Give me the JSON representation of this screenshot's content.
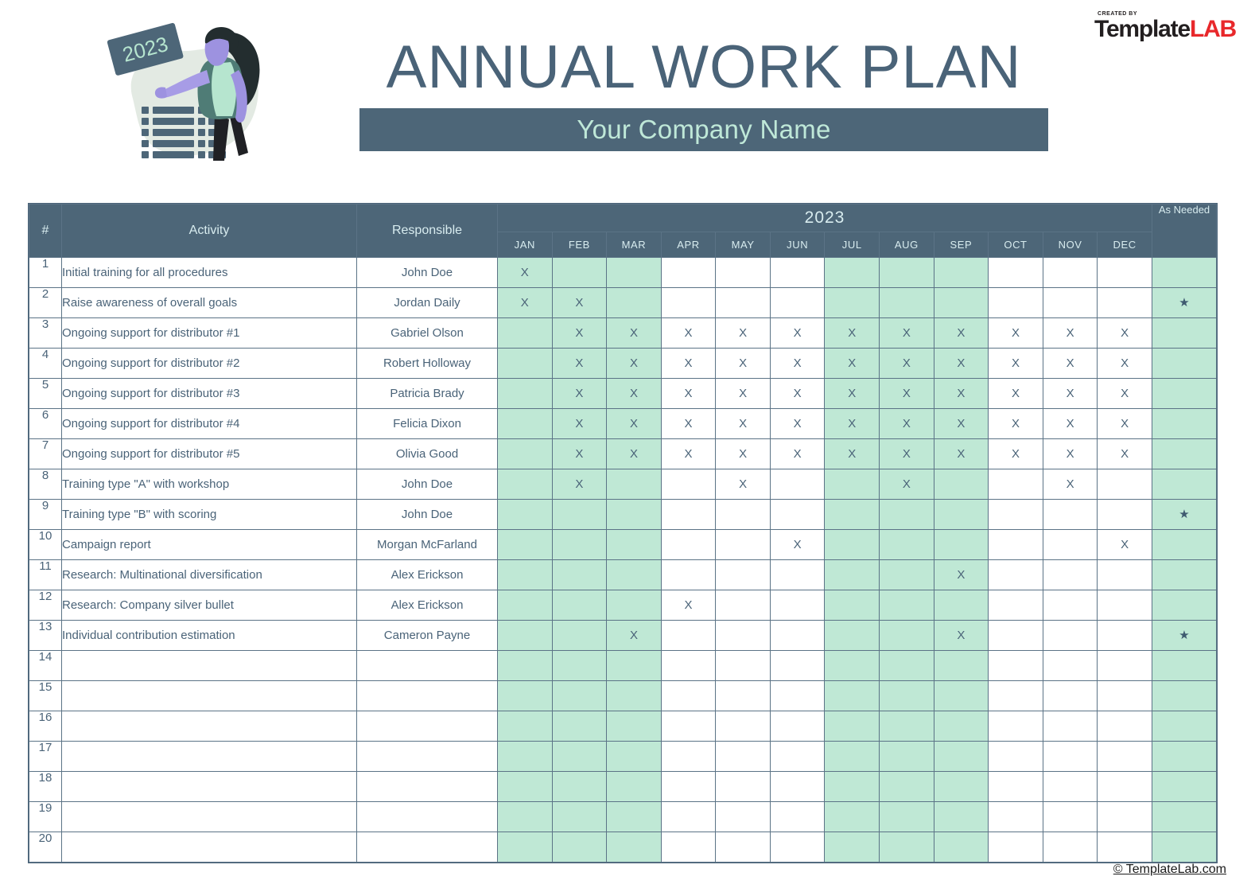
{
  "brand": {
    "created_by": "CREATED BY",
    "name_dark": "Template",
    "name_red": "LAB"
  },
  "header": {
    "title": "ANNUAL WORK PLAN",
    "company_name": "Your Company Name",
    "illustration_year": "2023",
    "illustration_name": "planner-woman-illustration"
  },
  "table": {
    "columns": {
      "number": "#",
      "activity": "Activity",
      "responsible": "Responsible",
      "year": "2023",
      "as_needed": "As Needed"
    },
    "months": [
      "JAN",
      "FEB",
      "MAR",
      "APR",
      "MAY",
      "JUN",
      "JUL",
      "AUG",
      "SEP",
      "OCT",
      "NOV",
      "DEC"
    ],
    "mark": "X",
    "star": "★",
    "shaded_month_indexes": [
      0,
      1,
      2,
      6,
      7,
      8
    ],
    "rows": [
      {
        "num": "1",
        "activity": "Initial training for all procedures",
        "responsible": "John Doe",
        "months": [
          "X",
          "",
          "",
          "",
          "",
          "",
          "",
          "",
          "",
          "",
          "",
          ""
        ],
        "as_needed": ""
      },
      {
        "num": "2",
        "activity": "Raise awareness of overall goals",
        "responsible": "Jordan Daily",
        "months": [
          "X",
          "X",
          "",
          "",
          "",
          "",
          "",
          "",
          "",
          "",
          "",
          ""
        ],
        "as_needed": "★"
      },
      {
        "num": "3",
        "activity": "Ongoing support for distributor #1",
        "responsible": "Gabriel Olson",
        "months": [
          "",
          "X",
          "X",
          "X",
          "X",
          "X",
          "X",
          "X",
          "X",
          "X",
          "X",
          "X"
        ],
        "as_needed": ""
      },
      {
        "num": "4",
        "activity": "Ongoing support for distributor #2",
        "responsible": "Robert Holloway",
        "months": [
          "",
          "X",
          "X",
          "X",
          "X",
          "X",
          "X",
          "X",
          "X",
          "X",
          "X",
          "X"
        ],
        "as_needed": ""
      },
      {
        "num": "5",
        "activity": "Ongoing support for distributor #3",
        "responsible": "Patricia Brady",
        "months": [
          "",
          "X",
          "X",
          "X",
          "X",
          "X",
          "X",
          "X",
          "X",
          "X",
          "X",
          "X"
        ],
        "as_needed": ""
      },
      {
        "num": "6",
        "activity": "Ongoing support for distributor #4",
        "responsible": "Felicia Dixon",
        "months": [
          "",
          "X",
          "X",
          "X",
          "X",
          "X",
          "X",
          "X",
          "X",
          "X",
          "X",
          "X"
        ],
        "as_needed": ""
      },
      {
        "num": "7",
        "activity": "Ongoing support for distributor #5",
        "responsible": "Olivia Good",
        "months": [
          "",
          "X",
          "X",
          "X",
          "X",
          "X",
          "X",
          "X",
          "X",
          "X",
          "X",
          "X"
        ],
        "as_needed": ""
      },
      {
        "num": "8",
        "activity": "Training type \"A\" with workshop",
        "responsible": "John Doe",
        "months": [
          "",
          "X",
          "",
          "",
          "X",
          "",
          "",
          "X",
          "",
          "",
          "X",
          ""
        ],
        "as_needed": ""
      },
      {
        "num": "9",
        "activity": "Training type \"B\" with scoring",
        "responsible": "John Doe",
        "months": [
          "",
          "",
          "",
          "",
          "",
          "",
          "",
          "",
          "",
          "",
          "",
          ""
        ],
        "as_needed": "★"
      },
      {
        "num": "10",
        "activity": "Campaign report",
        "responsible": "Morgan McFarland",
        "months": [
          "",
          "",
          "",
          "",
          "",
          "X",
          "",
          "",
          "",
          "",
          "",
          "X"
        ],
        "as_needed": ""
      },
      {
        "num": "11",
        "activity": "Research: Multinational diversification",
        "responsible": "Alex Erickson",
        "months": [
          "",
          "",
          "",
          "",
          "",
          "",
          "",
          "",
          "X",
          "",
          "",
          ""
        ],
        "as_needed": ""
      },
      {
        "num": "12",
        "activity": "Research: Company silver bullet",
        "responsible": "Alex Erickson",
        "months": [
          "",
          "",
          "",
          "X",
          "",
          "",
          "",
          "",
          "",
          "",
          "",
          ""
        ],
        "as_needed": ""
      },
      {
        "num": "13",
        "activity": "Individual contribution estimation",
        "responsible": "Cameron Payne",
        "months": [
          "",
          "",
          "X",
          "",
          "",
          "",
          "",
          "",
          "X",
          "",
          "",
          ""
        ],
        "as_needed": "★"
      },
      {
        "num": "14",
        "activity": "",
        "responsible": "",
        "months": [
          "",
          "",
          "",
          "",
          "",
          "",
          "",
          "",
          "",
          "",
          "",
          ""
        ],
        "as_needed": ""
      },
      {
        "num": "15",
        "activity": "",
        "responsible": "",
        "months": [
          "",
          "",
          "",
          "",
          "",
          "",
          "",
          "",
          "",
          "",
          "",
          ""
        ],
        "as_needed": ""
      },
      {
        "num": "16",
        "activity": "",
        "responsible": "",
        "months": [
          "",
          "",
          "",
          "",
          "",
          "",
          "",
          "",
          "",
          "",
          "",
          ""
        ],
        "as_needed": ""
      },
      {
        "num": "17",
        "activity": "",
        "responsible": "",
        "months": [
          "",
          "",
          "",
          "",
          "",
          "",
          "",
          "",
          "",
          "",
          "",
          ""
        ],
        "as_needed": ""
      },
      {
        "num": "18",
        "activity": "",
        "responsible": "",
        "months": [
          "",
          "",
          "",
          "",
          "",
          "",
          "",
          "",
          "",
          "",
          "",
          ""
        ],
        "as_needed": ""
      },
      {
        "num": "19",
        "activity": "",
        "responsible": "",
        "months": [
          "",
          "",
          "",
          "",
          "",
          "",
          "",
          "",
          "",
          "",
          "",
          ""
        ],
        "as_needed": ""
      },
      {
        "num": "20",
        "activity": "",
        "responsible": "",
        "months": [
          "",
          "",
          "",
          "",
          "",
          "",
          "",
          "",
          "",
          "",
          "",
          ""
        ],
        "as_needed": ""
      }
    ]
  },
  "footer": {
    "copyright": "© TemplateLab.com"
  },
  "colors": {
    "header_slate": "#4D6678",
    "title_slate": "#4A6378",
    "mint": "#BFE8D5",
    "mint_text": "#BFE8D8",
    "brand_red": "#E8282B"
  }
}
